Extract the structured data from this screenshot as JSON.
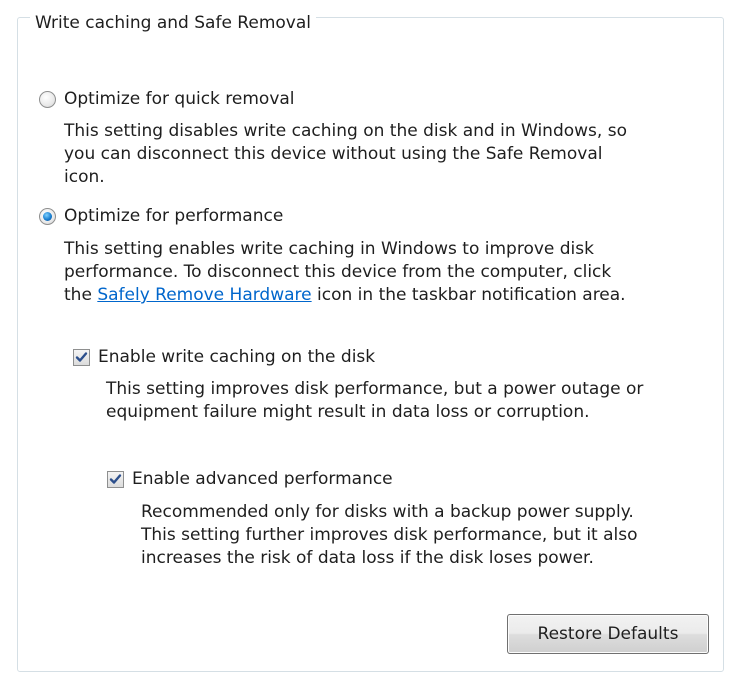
{
  "group": {
    "title": "Write caching and Safe Removal"
  },
  "quick_removal": {
    "label": "Optimize for quick removal",
    "selected": false,
    "desc": [
      "This setting disables write caching on the disk and in Windows, so",
      "you can disconnect this device without using the Safe Removal",
      "icon."
    ]
  },
  "performance": {
    "label": "Optimize for performance",
    "selected": true,
    "desc_line1": "This setting enables write caching in Windows to improve disk",
    "desc_line2": "performance. To disconnect this device from the computer, click",
    "desc_line3_prefix": "the ",
    "desc_line3_link": "Safely Remove Hardware",
    "desc_line3_suffix": " icon in the taskbar notification area."
  },
  "write_caching": {
    "label": "Enable write caching on the disk",
    "checked": true,
    "desc": [
      "This setting improves disk performance, but a power outage or",
      "equipment failure might result in data loss or corruption."
    ]
  },
  "advanced_performance": {
    "label": "Enable advanced performance",
    "checked": true,
    "desc": [
      "Recommended only for disks with a backup power supply.",
      "This setting further improves disk performance, but it also",
      "increases the risk of data loss if the disk loses power."
    ]
  },
  "restore_button": {
    "label": "Restore Defaults"
  },
  "colors": {
    "link": "#0066cc",
    "radio_dot": "#1a7fd0",
    "check_mark": "#2c4f8c",
    "group_border": "#d5dfe5"
  }
}
